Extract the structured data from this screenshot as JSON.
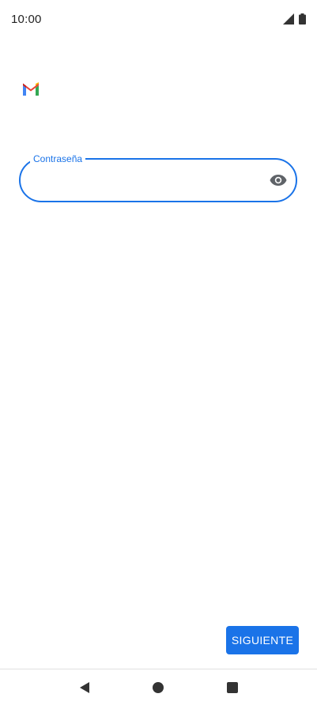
{
  "status_bar": {
    "time": "10:00",
    "icons": [
      "signal-icon",
      "battery-icon"
    ]
  },
  "app": {
    "logo": "gmail-logo"
  },
  "password_field": {
    "label": "Contraseña",
    "value": "",
    "toggle_icon": "eye-icon"
  },
  "actions": {
    "next_label": "SIGUIENTE"
  },
  "navigation": {
    "buttons": [
      "back-icon",
      "home-icon",
      "recents-icon"
    ]
  },
  "colors": {
    "accent": "#1a73e8",
    "icon_gray": "#5f6368"
  }
}
